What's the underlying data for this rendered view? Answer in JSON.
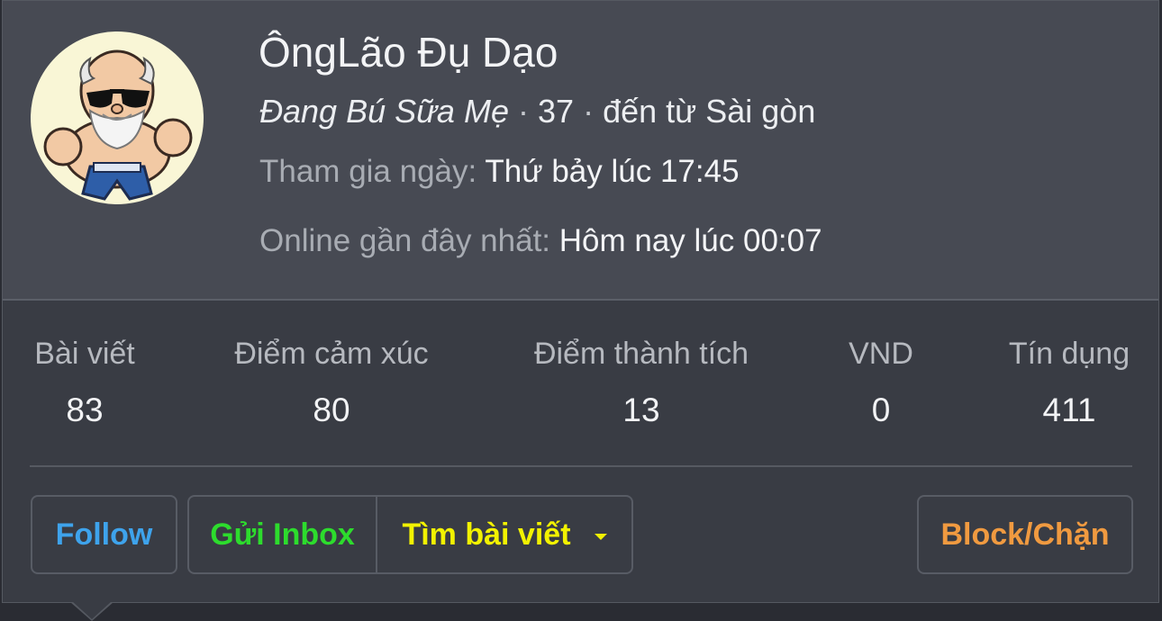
{
  "profile": {
    "name": "ÔngLão Đụ Dạo",
    "status": "Đang Bú Sữa Mẹ",
    "separator": "·",
    "age": "37",
    "location": "đến từ Sài gòn",
    "joined_label": "Tham gia ngày:",
    "joined_value": "Thứ bảy lúc 17:45",
    "online_label": "Online gần đây nhất:",
    "online_value": "Hôm nay lúc 00:07",
    "avatar_icon": "old-master-avatar"
  },
  "stats": [
    {
      "label": "Bài viết",
      "value": "83"
    },
    {
      "label": "Điểm cảm xúc",
      "value": "80"
    },
    {
      "label": "Điểm thành tích",
      "value": "13"
    },
    {
      "label": "VND",
      "value": "0"
    },
    {
      "label": "Tín dụng",
      "value": "411"
    }
  ],
  "actions": {
    "follow": "Follow",
    "inbox": "Gửi Inbox",
    "search_posts": "Tìm bài viết",
    "block": "Block/Chặn"
  },
  "colors": {
    "follow": "#3ea3ec",
    "inbox": "#2ddc2d",
    "search_posts": "#f2f200",
    "block": "#f09a40"
  }
}
